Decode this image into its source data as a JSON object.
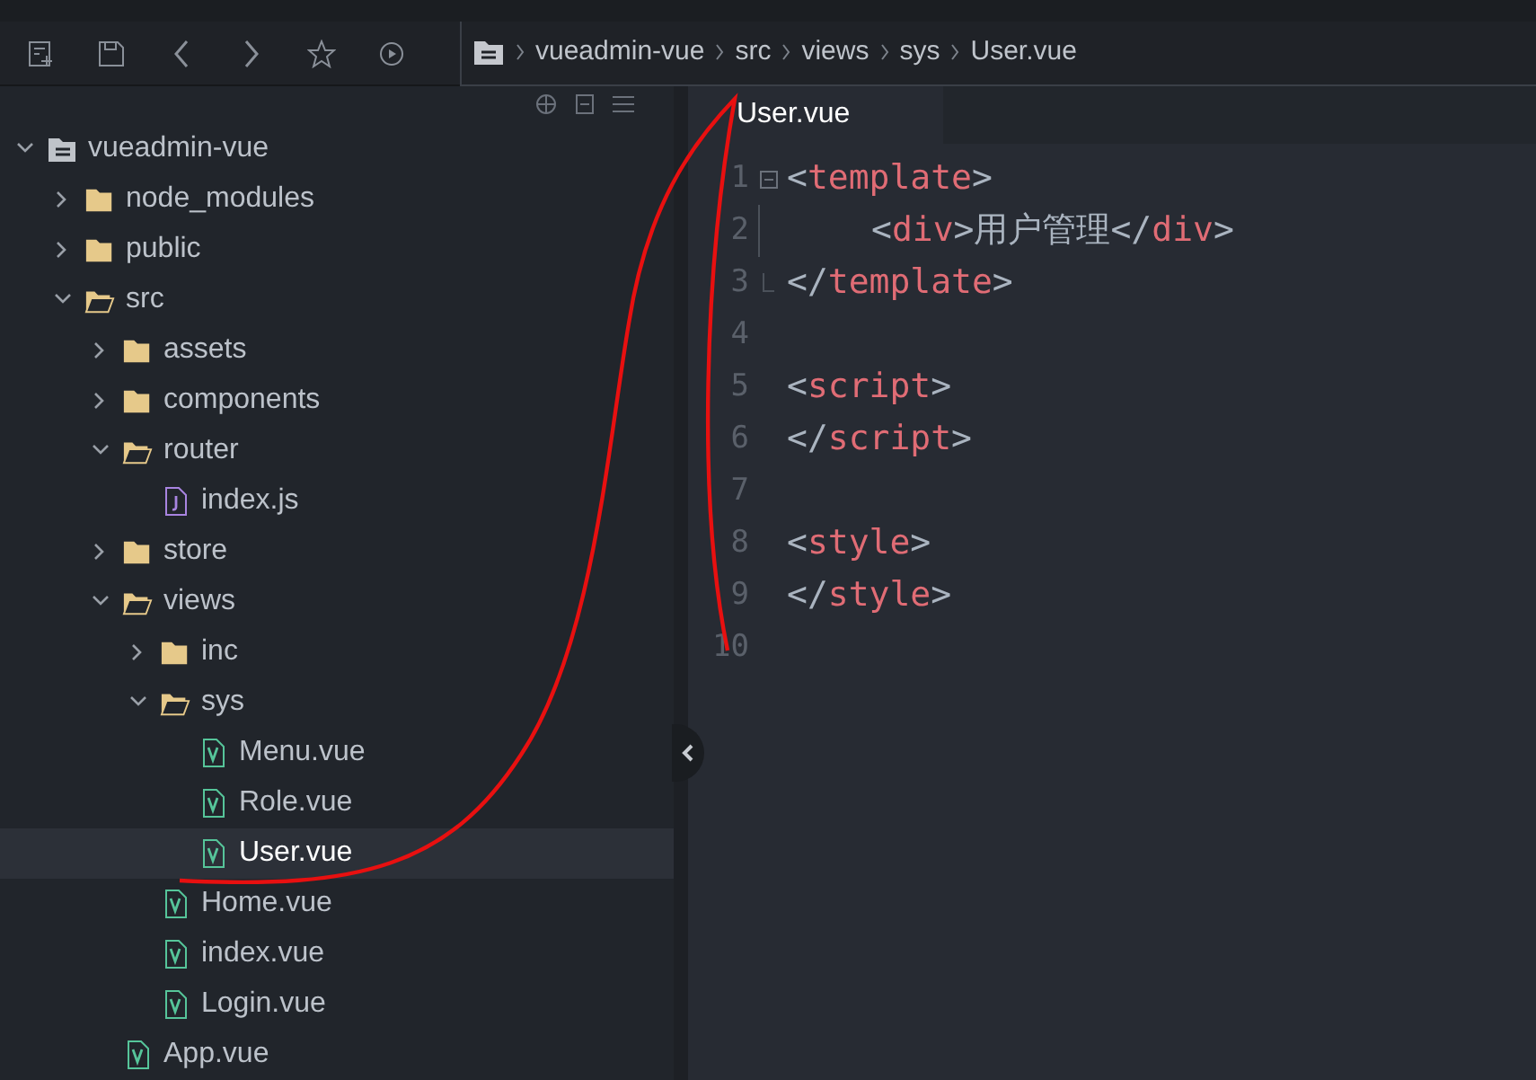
{
  "toolbar": {
    "buttons": [
      {
        "kind": "new"
      },
      {
        "kind": "save"
      },
      {
        "kind": "back"
      },
      {
        "kind": "forward"
      },
      {
        "kind": "star"
      },
      {
        "kind": "run"
      }
    ],
    "breadcrumb": [
      "vueadmin-vue",
      "src",
      "views",
      "sys",
      "User.vue"
    ]
  },
  "sidebar": {
    "tree": [
      {
        "label": "vueadmin-vue",
        "kind": "root",
        "expanded": true,
        "selected": false,
        "children": [
          {
            "label": "node_modules",
            "kind": "folder",
            "expanded": false,
            "selected": false
          },
          {
            "label": "public",
            "kind": "folder",
            "expanded": false,
            "selected": false
          },
          {
            "label": "src",
            "kind": "folder",
            "expanded": true,
            "selected": false,
            "children": [
              {
                "label": "assets",
                "kind": "folder",
                "expanded": false,
                "selected": false
              },
              {
                "label": "components",
                "kind": "folder",
                "expanded": false,
                "selected": false
              },
              {
                "label": "router",
                "kind": "folder",
                "expanded": true,
                "selected": false,
                "children": [
                  {
                    "label": "index.js",
                    "kind": "js",
                    "selected": false
                  }
                ]
              },
              {
                "label": "store",
                "kind": "folder",
                "expanded": false,
                "selected": false
              },
              {
                "label": "views",
                "kind": "folder",
                "expanded": true,
                "selected": false,
                "children": [
                  {
                    "label": "inc",
                    "kind": "folder",
                    "expanded": false,
                    "selected": false
                  },
                  {
                    "label": "sys",
                    "kind": "folder",
                    "expanded": true,
                    "selected": false,
                    "children": [
                      {
                        "label": "Menu.vue",
                        "kind": "vue",
                        "selected": false
                      },
                      {
                        "label": "Role.vue",
                        "kind": "vue",
                        "selected": false
                      },
                      {
                        "label": "User.vue",
                        "kind": "vue",
                        "selected": true
                      }
                    ]
                  },
                  {
                    "label": "Home.vue",
                    "kind": "vue",
                    "selected": false
                  },
                  {
                    "label": "index.vue",
                    "kind": "vue",
                    "selected": false
                  },
                  {
                    "label": "Login.vue",
                    "kind": "vue",
                    "selected": false
                  }
                ]
              },
              {
                "label": "App.vue",
                "kind": "vue",
                "selected": false
              }
            ]
          }
        ]
      }
    ]
  },
  "editor": {
    "tabs": [
      {
        "label": "User.vue",
        "selected": true
      }
    ],
    "lines": [
      {
        "number": "1",
        "kind": "fold_start",
        "tokens": [
          {
            "kind": "punct",
            "text": "<"
          },
          {
            "kind": "tag",
            "text": "template"
          },
          {
            "kind": "punct",
            "text": ">"
          }
        ]
      },
      {
        "number": "2",
        "kind": "indented",
        "tokens": [
          {
            "kind": "punct",
            "text": "<"
          },
          {
            "kind": "tag",
            "text": "div"
          },
          {
            "kind": "punct",
            "text": ">"
          },
          {
            "kind": "text",
            "text": "用户管理"
          },
          {
            "kind": "punct",
            "text": "</"
          },
          {
            "kind": "tag",
            "text": "div"
          },
          {
            "kind": "punct",
            "text": ">"
          }
        ]
      },
      {
        "number": "3",
        "kind": "fold_end",
        "tokens": [
          {
            "kind": "punct",
            "text": "</"
          },
          {
            "kind": "tag",
            "text": "template"
          },
          {
            "kind": "punct",
            "text": ">"
          }
        ]
      },
      {
        "number": "4"
      },
      {
        "number": "5",
        "tokens": [
          {
            "kind": "punct",
            "text": "<"
          },
          {
            "kind": "tag",
            "text": "script"
          },
          {
            "kind": "punct",
            "text": ">"
          }
        ]
      },
      {
        "number": "6",
        "tokens": [
          {
            "kind": "punct",
            "text": "</"
          },
          {
            "kind": "tag",
            "text": "script"
          },
          {
            "kind": "punct",
            "text": ">"
          }
        ]
      },
      {
        "number": "7"
      },
      {
        "number": "8",
        "tokens": [
          {
            "kind": "punct",
            "text": "<"
          },
          {
            "kind": "tag",
            "text": "style"
          },
          {
            "kind": "punct",
            "text": ">"
          }
        ]
      },
      {
        "number": "9",
        "tokens": [
          {
            "kind": "punct",
            "text": "</"
          },
          {
            "kind": "tag",
            "text": "style"
          },
          {
            "kind": "punct",
            "text": ">"
          }
        ]
      },
      {
        "number": "10"
      }
    ]
  }
}
